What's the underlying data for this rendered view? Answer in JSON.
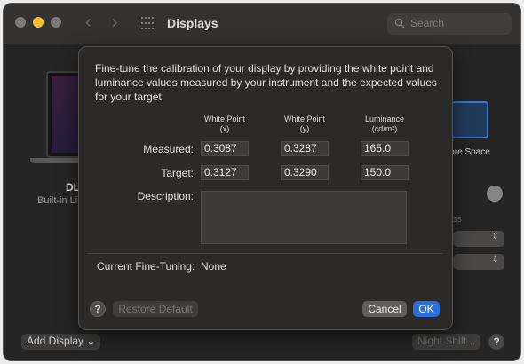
{
  "window": {
    "title": "Displays",
    "search_placeholder": "Search"
  },
  "background": {
    "display_name": "DL",
    "display_subtitle": "Built-in Li",
    "more_space_label": "lore Space",
    "section_label": "ss",
    "add_display_label": "Add Display",
    "night_shift_label": "Night Shift...",
    "help_label": "?"
  },
  "sheet": {
    "intro_text": "Fine-tune the calibration of your display by providing the white point and luminance values measured by your instrument and the expected values for your target.",
    "columns": [
      {
        "line1": "White Point",
        "line2": "(x)"
      },
      {
        "line1": "White Point",
        "line2": "(y)"
      },
      {
        "line1": "Luminance",
        "line2": "(cd/m²)"
      }
    ],
    "measured": {
      "label": "Measured:",
      "values": [
        "0.3087",
        "0.3287",
        "165.0"
      ]
    },
    "target": {
      "label": "Target:",
      "values": [
        "0.3127",
        "0.3290",
        "150.0"
      ]
    },
    "description_label": "Description:",
    "description_value": "",
    "current_label": "Current Fine-Tuning:",
    "current_value": "None",
    "help_label": "?",
    "restore_label": "Restore Default",
    "cancel_label": "Cancel",
    "ok_label": "OK"
  },
  "colors": {
    "accent": "#2b6fd8",
    "window_bg": "#262525",
    "sheet_bg": "#2b2a29",
    "traffic_yellow": "#f6be33"
  }
}
